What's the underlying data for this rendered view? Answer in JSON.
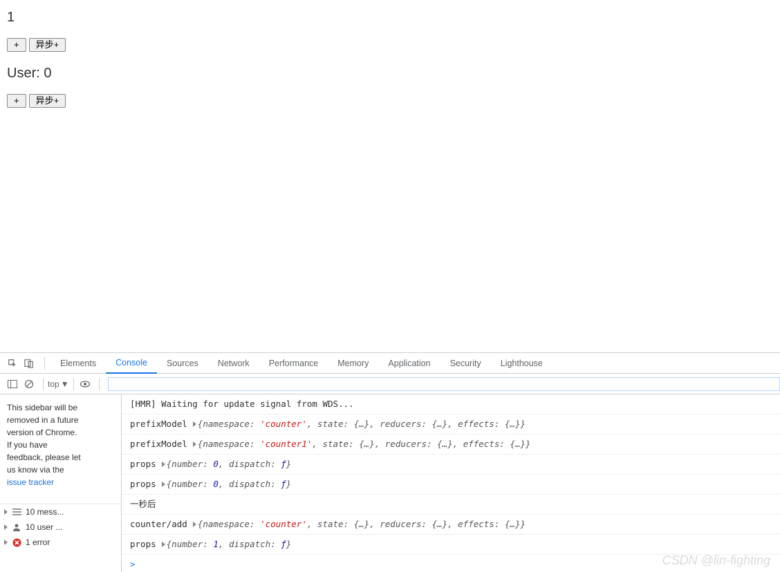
{
  "page": {
    "counter_value": "1",
    "user_label": "User: ",
    "user_value": "0",
    "counter_btn_plus": "+",
    "counter_btn_async": "异步+",
    "user_btn_plus": "+",
    "user_btn_async": "异步+"
  },
  "devtools": {
    "tabs": {
      "elements": "Elements",
      "console": "Console",
      "sources": "Sources",
      "network": "Network",
      "performance": "Performance",
      "memory": "Memory",
      "application": "Application",
      "security": "Security",
      "lighthouse": "Lighthouse"
    },
    "active_tab": "console",
    "filterbar": {
      "context": "top",
      "filter_value": ""
    },
    "sidebar": {
      "note_line1": "This sidebar will be",
      "note_line2": "removed in a future",
      "note_line3": "version of Chrome.",
      "note_line4": "If you have",
      "note_line5": "feedback, please let",
      "note_line6": "us know via the",
      "note_link": "issue tracker",
      "stat_messages": "10 mess...",
      "stat_user": "10 user ...",
      "stat_error": "1 error"
    },
    "console_lines": [
      {
        "type": "plain",
        "text": "[HMR] Waiting for update signal from WDS..."
      },
      {
        "type": "obj",
        "label": "prefixModel",
        "keys": [
          "namespace",
          "state",
          "reducers",
          "effects"
        ],
        "str0": "'counter'"
      },
      {
        "type": "obj",
        "label": "prefixModel",
        "keys": [
          "namespace",
          "state",
          "reducers",
          "effects"
        ],
        "str0": "'counter1'"
      },
      {
        "type": "obj",
        "label": "props",
        "keys": [
          "number",
          "dispatch"
        ],
        "num0": "0",
        "fn1": "ƒ"
      },
      {
        "type": "obj",
        "label": "props",
        "keys": [
          "number",
          "dispatch"
        ],
        "num0": "0",
        "fn1": "ƒ"
      },
      {
        "type": "plain",
        "text": "一秒后"
      },
      {
        "type": "obj",
        "label": "counter/add",
        "keys": [
          "namespace",
          "state",
          "reducers",
          "effects"
        ],
        "str0": "'counter'"
      },
      {
        "type": "obj",
        "label": "props",
        "keys": [
          "number",
          "dispatch"
        ],
        "num0": "1",
        "fn1": "ƒ"
      }
    ],
    "prompt": ">"
  },
  "watermark": "CSDN @lin-fighting",
  "colors": {
    "active": "#1a73e8",
    "error": "#d93025"
  }
}
